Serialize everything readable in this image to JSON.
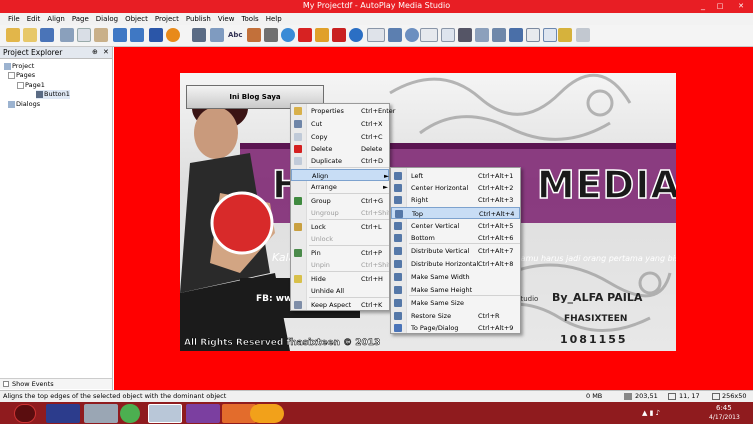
{
  "window": {
    "title": "My Projectdf - AutoPlay Media Studio",
    "min": "_",
    "max": "□",
    "close": "✕"
  },
  "menubar": [
    "File",
    "Edit",
    "Align",
    "Page",
    "Dialog",
    "Object",
    "Project",
    "Publish",
    "View",
    "Tools",
    "Help"
  ],
  "toolbar": {
    "abc_label": "Abc"
  },
  "explorer": {
    "title": "Project Explorer",
    "pin": "⊕",
    "close": "✕",
    "items": [
      {
        "label": "Project",
        "icon": "project-icon"
      },
      {
        "label": "Pages",
        "icon": "pages-icon"
      },
      {
        "label": "Page1",
        "icon": "page-icon"
      },
      {
        "label": "Button1",
        "icon": "button-object-icon"
      },
      {
        "label": "Dialogs",
        "icon": "dialogs-icon"
      }
    ],
    "show_events": "Show Events"
  },
  "canvas": {
    "button_label": "Ini Blog Saya",
    "studio_text": "HASIXTEEN MEDIA STUDIO",
    "tagline_left": "Kalau d",
    "tagline_right": "kamu harus jadi orang pertama yang bisa",
    "fb_text": "FB: www.fac",
    "studio_small": "Studio",
    "by_text": "By_ALFA PAILA",
    "fhasixteen": "FHASIXTEEN",
    "phone": "1081155",
    "footer": "All Rights Reserved  fhasixteen © 2013"
  },
  "context_menu": {
    "items": [
      {
        "label": "Properties",
        "shortcut": "Ctrl+Enter",
        "icon": "properties-icon",
        "disabled": false
      },
      {
        "label": "Cut",
        "shortcut": "Ctrl+X",
        "icon": "cut-icon",
        "disabled": false
      },
      {
        "label": "Copy",
        "shortcut": "Ctrl+C",
        "icon": "copy-icon",
        "disabled": false
      },
      {
        "label": "Delete",
        "shortcut": "Delete",
        "icon": "delete-icon",
        "disabled": false
      },
      {
        "label": "Duplicate",
        "shortcut": "Ctrl+D",
        "icon": "duplicate-icon",
        "disabled": false
      },
      {
        "label": "Align",
        "shortcut": "►",
        "icon": "",
        "disabled": false,
        "highlighted": true
      },
      {
        "label": "Arrange",
        "shortcut": "►",
        "icon": "",
        "disabled": false
      },
      {
        "label": "Group",
        "shortcut": "Ctrl+G",
        "icon": "group-icon",
        "disabled": false
      },
      {
        "label": "Ungroup",
        "shortcut": "Ctrl+Shift+G",
        "icon": "",
        "disabled": true
      },
      {
        "label": "Lock",
        "shortcut": "Ctrl+L",
        "icon": "lock-icon",
        "disabled": false
      },
      {
        "label": "Unlock",
        "shortcut": "",
        "icon": "",
        "disabled": true
      },
      {
        "label": "Pin",
        "shortcut": "Ctrl+P",
        "icon": "pin-icon",
        "disabled": false
      },
      {
        "label": "Unpin",
        "shortcut": "Ctrl+Shift+P",
        "icon": "",
        "disabled": true
      },
      {
        "label": "Hide",
        "shortcut": "Ctrl+H",
        "icon": "hide-icon",
        "disabled": false
      },
      {
        "label": "Unhide All",
        "shortcut": "",
        "icon": "",
        "disabled": false
      },
      {
        "label": "Keep Aspect",
        "shortcut": "Ctrl+K",
        "icon": "keep-aspect-icon",
        "disabled": false
      }
    ]
  },
  "align_submenu": {
    "items": [
      {
        "label": "Left",
        "shortcut": "Ctrl+Alt+1",
        "icon": "align-left-icon"
      },
      {
        "label": "Center Horizontal",
        "shortcut": "Ctrl+Alt+2",
        "icon": "align-center-horizontal-icon"
      },
      {
        "label": "Right",
        "shortcut": "Ctrl+Alt+3",
        "icon": "align-right-icon"
      },
      {
        "label": "Top",
        "shortcut": "Ctrl+Alt+4",
        "icon": "align-top-icon",
        "highlighted": true
      },
      {
        "label": "Center Vertical",
        "shortcut": "Ctrl+Alt+5",
        "icon": "align-center-vertical-icon"
      },
      {
        "label": "Bottom",
        "shortcut": "Ctrl+Alt+6",
        "icon": "align-bottom-icon"
      },
      {
        "label": "Distribute Vertical",
        "shortcut": "Ctrl+Alt+7",
        "icon": "distribute-vertical-icon"
      },
      {
        "label": "Distribute Horizontal",
        "shortcut": "Ctrl+Alt+8",
        "icon": "distribute-horizontal-icon"
      },
      {
        "label": "Make Same Width",
        "shortcut": "",
        "icon": "same-width-icon"
      },
      {
        "label": "Make Same Height",
        "shortcut": "",
        "icon": "same-height-icon"
      },
      {
        "label": "Make Same Size",
        "shortcut": "",
        "icon": "same-size-icon"
      },
      {
        "label": "Restore Size",
        "shortcut": "Ctrl+R",
        "icon": "restore-size-icon"
      },
      {
        "label": "To Page/Dialog",
        "shortcut": "Ctrl+Alt+9",
        "icon": "to-page-check-icon"
      }
    ]
  },
  "status": {
    "hint": "Aligns the top edges of the selected object with the dominant object",
    "memory": "0 MB",
    "position": "203,51",
    "object_pos": "11, 17",
    "object_size": "256x50"
  },
  "taskbar": {
    "time": "6:45",
    "date": "4/17/2013"
  }
}
